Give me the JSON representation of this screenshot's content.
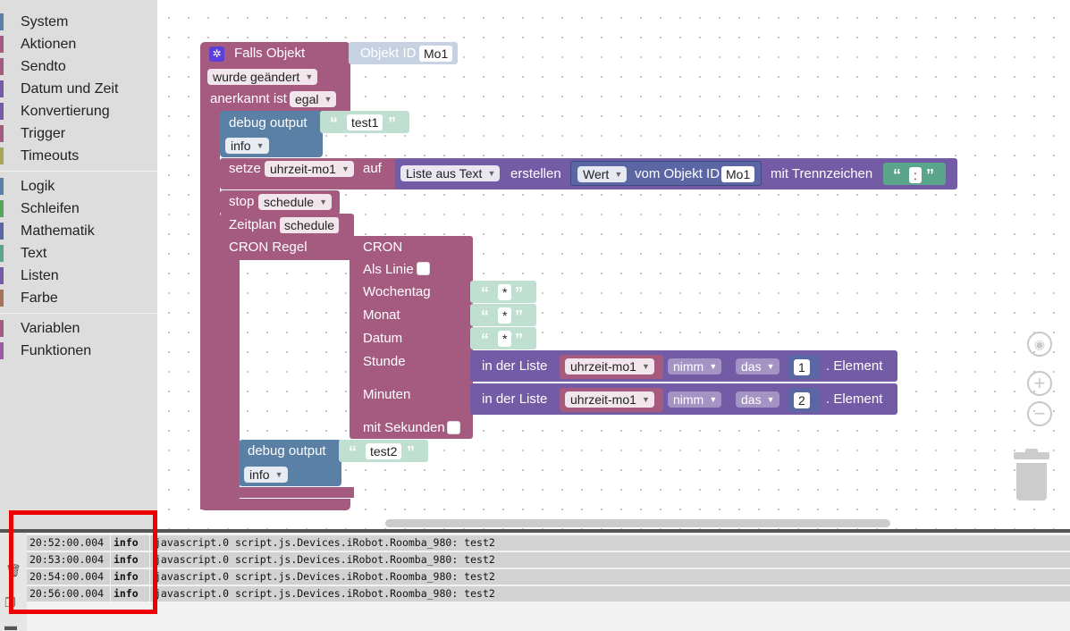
{
  "toolbox": {
    "groups": [
      [
        {
          "label": "System",
          "color": "#5b80a5"
        },
        {
          "label": "Aktionen",
          "color": "#a55b80"
        },
        {
          "label": "Sendto",
          "color": "#a55b80"
        },
        {
          "label": "Datum und Zeit",
          "color": "#745ba5"
        },
        {
          "label": "Konvertierung",
          "color": "#745ba5"
        },
        {
          "label": "Trigger",
          "color": "#a55b80"
        },
        {
          "label": "Timeouts",
          "color": "#a5a55b"
        }
      ],
      [
        {
          "label": "Logik",
          "color": "#5b80a5"
        },
        {
          "label": "Schleifen",
          "color": "#5ba55b"
        },
        {
          "label": "Mathematik",
          "color": "#5b67a5"
        },
        {
          "label": "Text",
          "color": "#5ba58c"
        },
        {
          "label": "Listen",
          "color": "#745ba5"
        },
        {
          "label": "Farbe",
          "color": "#a5745b"
        }
      ],
      [
        {
          "label": "Variablen",
          "color": "#a55b80"
        },
        {
          "label": "Funktionen",
          "color": "#995ba5"
        }
      ]
    ]
  },
  "blocks": {
    "trigger": {
      "label": "Falls Objekt",
      "object_id_label": "Objekt ID",
      "object_id": "Mo1",
      "changed": "wurde geändert",
      "ack_label": "anerkannt ist",
      "ack_value": "egal"
    },
    "debug1": {
      "label": "debug output",
      "text": "test1",
      "level": "info"
    },
    "setze": {
      "label": "setze",
      "var": "uhrzeit-mo1",
      "auf": "auf",
      "list_from_text": "Liste aus Text",
      "create": "erstellen",
      "value": "Wert",
      "from_object": "vom Objekt ID",
      "object_id": "Mo1",
      "separator_label": "mit Trennzeichen",
      "separator": ":"
    },
    "stop": {
      "label": "stop",
      "value": "schedule"
    },
    "schedule": {
      "label": "Zeitplan",
      "value": "schedule",
      "cron_rule": "CRON Regel"
    },
    "cron": {
      "title": "CRON",
      "als_linie": "Als Linie",
      "wochentag": "Wochentag",
      "monat": "Monat",
      "datum": "Datum",
      "stunde": "Stunde",
      "minuten": "Minuten",
      "mit_sekunden": "mit Sekunden",
      "star": "*"
    },
    "list_get1": {
      "in_list": "in der Liste",
      "var": "uhrzeit-mo1",
      "mode": "nimm",
      "where": "das",
      "index": "1",
      "element": "Element"
    },
    "list_get2": {
      "in_list": "in der Liste",
      "var": "uhrzeit-mo1",
      "mode": "nimm",
      "where": "das",
      "index": "2",
      "element": "Element"
    },
    "debug2": {
      "label": "debug output",
      "text": "test2",
      "level": "info"
    }
  },
  "log": {
    "rows": [
      {
        "time": "20:52:00.004",
        "level": "info",
        "message": "javascript.0 script.js.Devices.iRobot.Roomba_980: test2"
      },
      {
        "time": "20:53:00.004",
        "level": "info",
        "message": "javascript.0 script.js.Devices.iRobot.Roomba_980: test2"
      },
      {
        "time": "20:54:00.004",
        "level": "info",
        "message": "javascript.0 script.js.Devices.iRobot.Roomba_980: test2"
      },
      {
        "time": "20:56:00.004",
        "level": "info",
        "message": "javascript.0 script.js.Devices.iRobot.Roomba_980: test2"
      }
    ]
  },
  "colors": {
    "trigger_purple": "#a55b80",
    "debug_blue": "#5b80a5",
    "list_purple": "#745ba5",
    "text_teal": "#bfdfd0",
    "highlight_red": "#ee0000"
  }
}
